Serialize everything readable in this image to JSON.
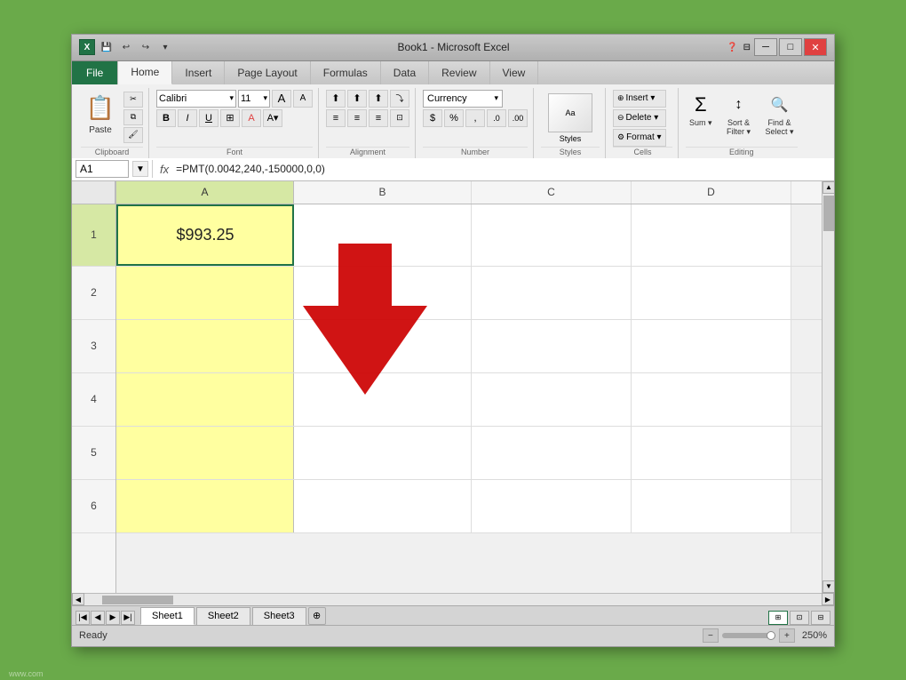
{
  "window": {
    "title": "Book1 - Microsoft Excel",
    "icon": "X"
  },
  "title_bar": {
    "title": "Book1 - Microsoft Excel",
    "minimize": "─",
    "maximize": "□",
    "close": "✕",
    "quick_save": "💾",
    "undo": "↩",
    "redo": "↪",
    "dropdown": "▾"
  },
  "ribbon": {
    "tabs": [
      "File",
      "Home",
      "Insert",
      "Page Layout",
      "Formulas",
      "Data",
      "Review",
      "View"
    ],
    "active_tab": "Home",
    "groups": {
      "clipboard": {
        "label": "Clipboard",
        "paste_label": "Paste",
        "cut_label": "✂",
        "copy_label": "⧉",
        "format_painter_label": "🖌"
      },
      "font": {
        "label": "Font",
        "font_name": "Calibri",
        "font_size": "11",
        "bold": "B",
        "italic": "I",
        "underline": "U",
        "border": "⊞",
        "fill_color": "A",
        "font_color": "A"
      },
      "alignment": {
        "label": "Alignment",
        "align_top": "≡",
        "align_middle": "≡",
        "align_bottom": "≡",
        "align_left": "≡",
        "align_center": "≡",
        "align_right": "≡",
        "indent_decrease": "⇤",
        "indent_increase": "⇥",
        "wrap_text": "⤵",
        "merge": "⊡"
      },
      "number": {
        "label": "Number",
        "format": "Currency",
        "dollar": "$",
        "percent": "%",
        "comma": ",",
        "increase_decimal": ".0",
        "decrease_decimal": ".00"
      },
      "styles": {
        "label": "Styles",
        "styles_label": "Styles"
      },
      "cells": {
        "label": "Cells",
        "insert": "Insert ▾",
        "delete": "Delete ▾",
        "format": "Format ▾"
      },
      "editing": {
        "label": "Editing",
        "sum_label": "Σ",
        "sort_label": "Sort &\nFilter ▾",
        "find_label": "Find &\nSelect ▾"
      }
    }
  },
  "formula_bar": {
    "cell_ref": "A1",
    "formula": "=PMT(0.0042,240,-150000,0,0)"
  },
  "spreadsheet": {
    "columns": [
      "A",
      "B",
      "C",
      "D"
    ],
    "rows": [
      "1",
      "2",
      "3",
      "4",
      "5",
      "6"
    ],
    "active_cell": "A1",
    "active_value": "$993.25"
  },
  "sheet_tabs": {
    "tabs": [
      "Sheet1",
      "Sheet2",
      "Sheet3"
    ],
    "active_tab": "Sheet1",
    "add_sheet": "+"
  },
  "status_bar": {
    "ready": "Ready",
    "zoom": "250%",
    "zoom_out": "−",
    "zoom_in": "+"
  },
  "arrow": {
    "color": "#cc0000"
  }
}
